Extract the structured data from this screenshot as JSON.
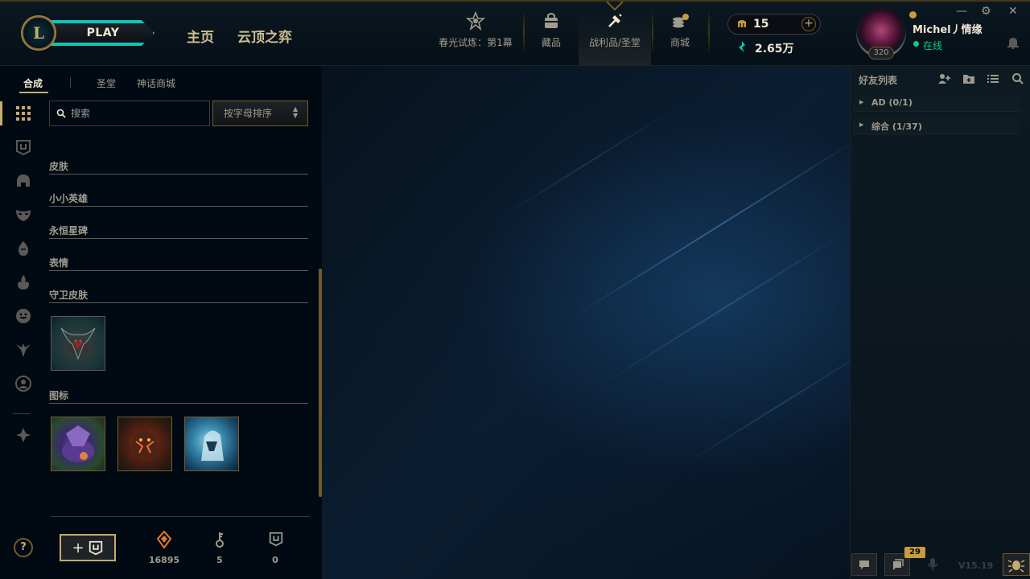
{
  "topbar": {
    "logo_letter": "L",
    "play_label": "PLAY",
    "nav": [
      "主页",
      "云顶之弈"
    ],
    "tabs": [
      {
        "label": "春光试炼：第1幕",
        "icon": "trial-icon"
      },
      {
        "label": "藏品",
        "icon": "collection-bag-icon"
      },
      {
        "label": "战利品/圣堂",
        "icon": "loot-hammer-icon"
      },
      {
        "label": "商城",
        "icon": "store-coins-icon"
      }
    ],
    "rp_amount": "15",
    "be_amount": "2.65万",
    "plus": "+"
  },
  "profile": {
    "level": "320",
    "username": "Michel丿情缘",
    "status": "在线"
  },
  "window_controls": {
    "minimize": "—",
    "settings": "⚙",
    "close": "✕"
  },
  "loot": {
    "subtabs": [
      "合成",
      "圣堂",
      "神话商城"
    ],
    "search_placeholder": "搜索",
    "sort_label": "按字母排序",
    "categories": [
      "皮肤",
      "小小英雄",
      "永恒星碑",
      "表情",
      "守卫皮肤",
      "图标"
    ],
    "counts": {
      "orange_essence": "16895",
      "keys": "5",
      "chests": "0"
    },
    "craft_plus": "+"
  },
  "help": "?",
  "friends": {
    "title": "好友列表",
    "groups": [
      "AD (0/1)",
      "综合 (1/37)"
    ]
  },
  "footer": {
    "chat_count": "29",
    "version": "V15.19"
  },
  "colors": {
    "gold": "#c8aa6e",
    "teal": "#0ac8b9",
    "online": "#0acf83",
    "bg": "#010a13"
  }
}
